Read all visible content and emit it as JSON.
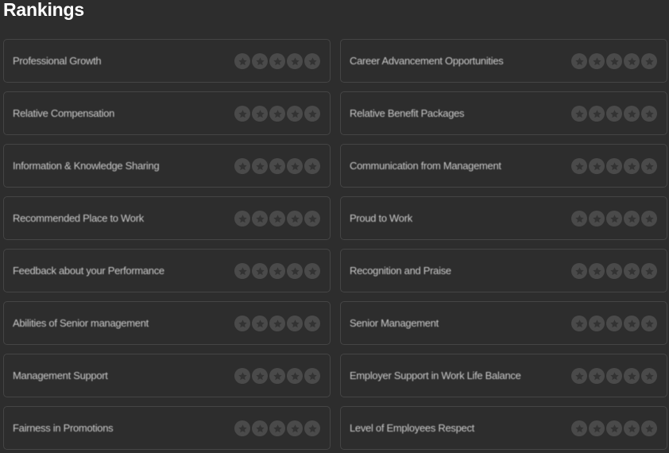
{
  "page": {
    "title": "Rankings"
  },
  "colors": {
    "background": "#2d2d2d",
    "card_border": "#454545",
    "label_text": "#c9c9c9",
    "star_circle": "#4a4a4a",
    "star_glyph": "#333333"
  },
  "rankings": [
    {
      "label": "Professional Growth",
      "rating": 0,
      "max_rating": 5
    },
    {
      "label": "Career Advancement Opportunities",
      "rating": 0,
      "max_rating": 5
    },
    {
      "label": "Relative Compensation",
      "rating": 0,
      "max_rating": 5
    },
    {
      "label": "Relative Benefit Packages",
      "rating": 0,
      "max_rating": 5
    },
    {
      "label": "Information & Knowledge Sharing",
      "rating": 0,
      "max_rating": 5
    },
    {
      "label": "Communication from Management",
      "rating": 0,
      "max_rating": 5
    },
    {
      "label": "Recommended Place to Work",
      "rating": 0,
      "max_rating": 5
    },
    {
      "label": "Proud to Work",
      "rating": 0,
      "max_rating": 5
    },
    {
      "label": "Feedback about your Performance",
      "rating": 0,
      "max_rating": 5
    },
    {
      "label": "Recognition and Praise",
      "rating": 0,
      "max_rating": 5
    },
    {
      "label": "Abilities of Senior management",
      "rating": 0,
      "max_rating": 5
    },
    {
      "label": "Senior Management",
      "rating": 0,
      "max_rating": 5
    },
    {
      "label": "Management Support",
      "rating": 0,
      "max_rating": 5
    },
    {
      "label": "Employer Support in Work Life Balance",
      "rating": 0,
      "max_rating": 5
    },
    {
      "label": "Fairness in Promotions",
      "rating": 0,
      "max_rating": 5
    },
    {
      "label": "Level of Employees Respect",
      "rating": 0,
      "max_rating": 5
    }
  ]
}
